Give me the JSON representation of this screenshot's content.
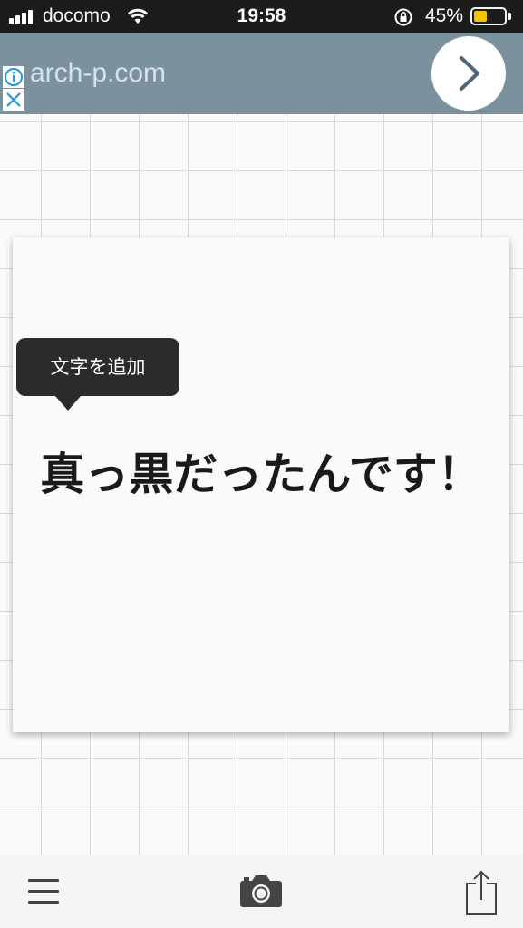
{
  "status_bar": {
    "carrier": "docomo",
    "time": "19:58",
    "battery_percent": "45%",
    "battery_level": 0.45,
    "battery_color": "#ffcc00",
    "icons": [
      "signal-bars-icon",
      "wifi-icon",
      "orientation-lock-icon",
      "battery-icon"
    ]
  },
  "ad_banner": {
    "text": "arch-p.com",
    "icons": [
      "info-icon",
      "close-icon",
      "chevron-right-icon"
    ],
    "background": "#7b919e"
  },
  "canvas": {
    "main_text": "真っ黒だったんです！",
    "tooltip": "文字を追加"
  },
  "toolbar": {
    "icons": [
      "menu-icon",
      "camera-icon",
      "share-icon"
    ]
  }
}
